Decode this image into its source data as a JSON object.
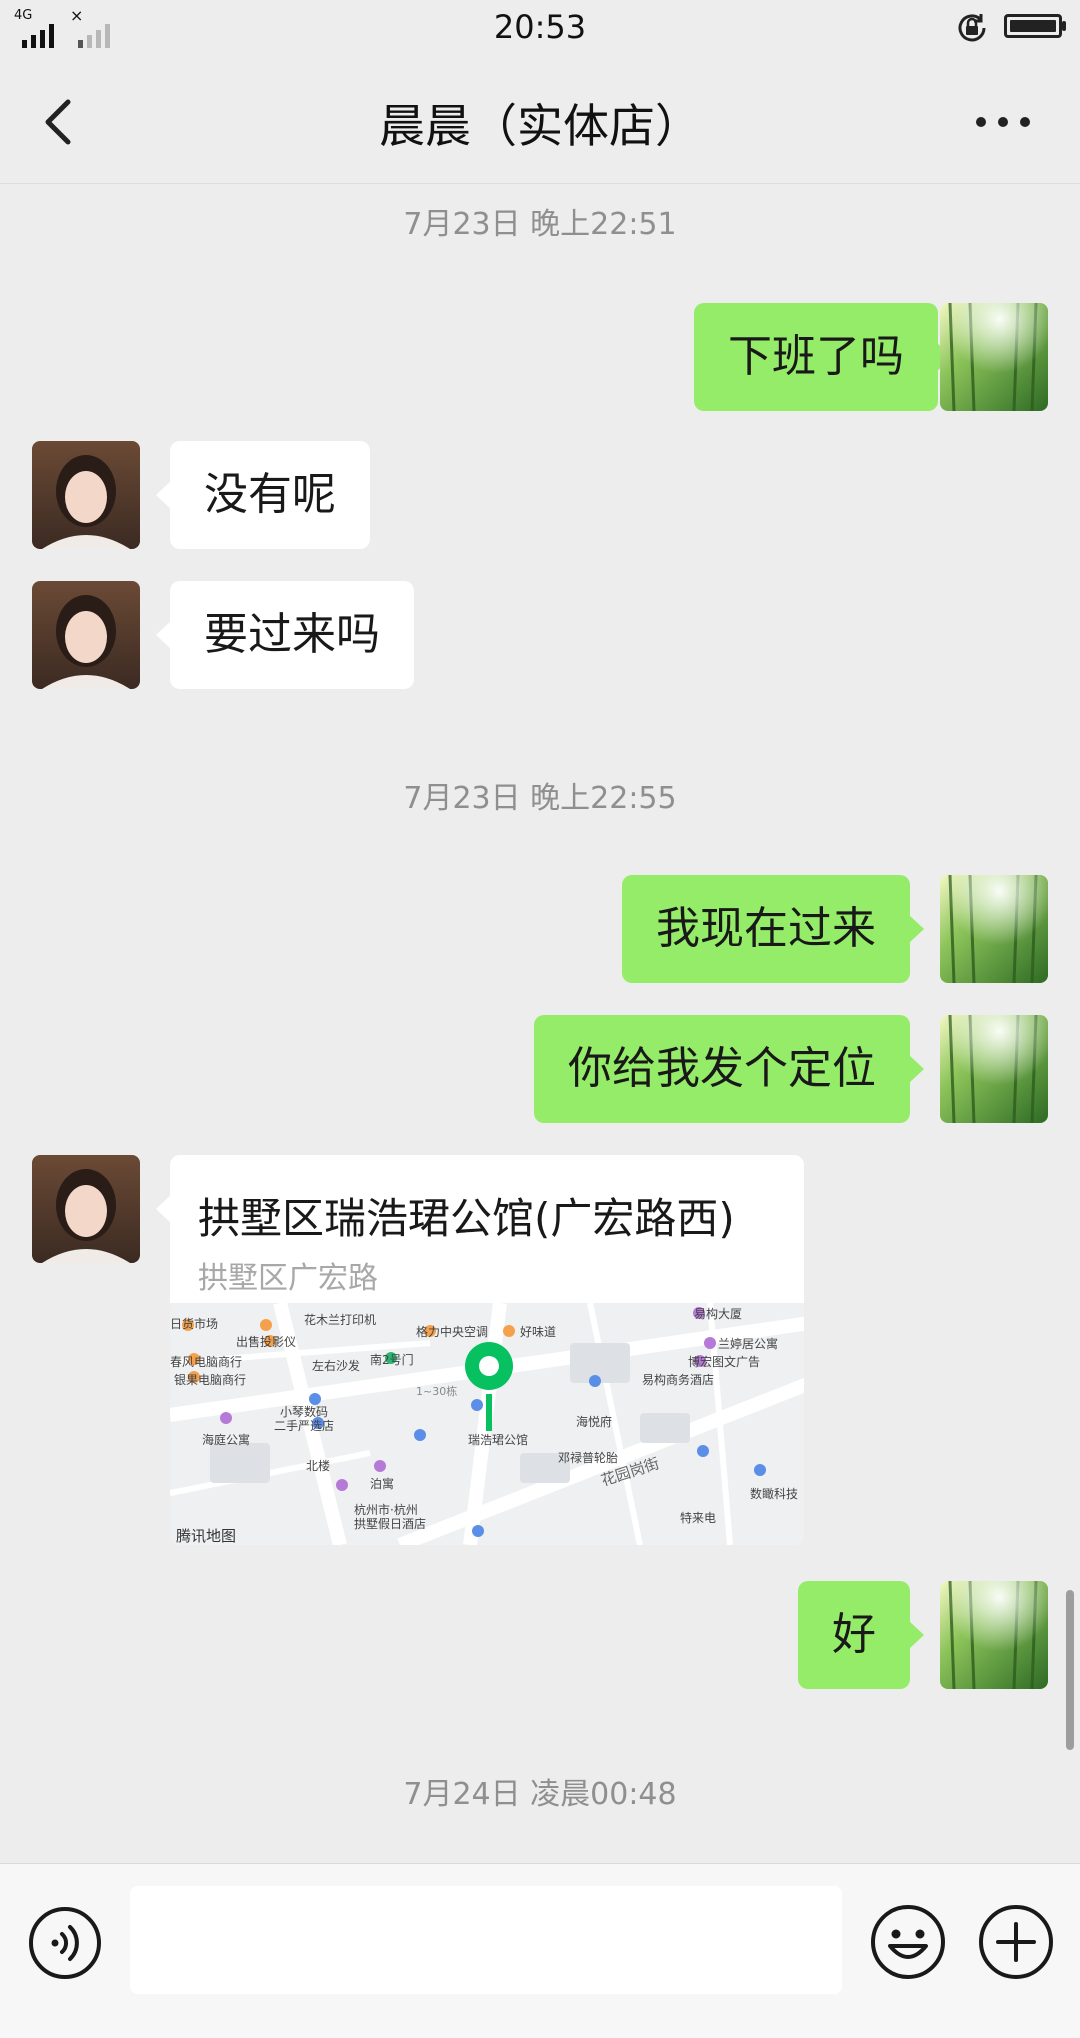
{
  "status_bar": {
    "time": "20:53",
    "network": "4G",
    "no_service": "×"
  },
  "nav": {
    "title": "晨晨（实体店）",
    "back_icon": "chevron-left-icon",
    "more_icon": "more-dots-icon"
  },
  "chat": {
    "timestamps": [
      "7月23日 晚上22:51",
      "7月23日 晚上22:55",
      "7月24日 凌晨00:48"
    ],
    "messages": [
      {
        "side": "sent",
        "text": "下班了吗"
      },
      {
        "side": "recv",
        "text": "没有呢"
      },
      {
        "side": "recv",
        "text": "要过来吗"
      },
      {
        "side": "sent",
        "text": "我现在过来"
      },
      {
        "side": "sent",
        "text": "你给我发个定位"
      },
      {
        "side": "sent",
        "text": "好"
      }
    ],
    "location": {
      "title": "拱墅区瑞浩珺公馆(广宏路西)",
      "address": "拱墅区广宏路",
      "map_provider": "腾讯地图",
      "map_labels": [
        "日货市场",
        "出售投影仪",
        "花木兰打印机",
        "格力中央空调",
        "好味道",
        "易构大厦",
        "兰婷居公寓",
        "博宏图文广告",
        "易构商务酒店",
        "春风电脑商行",
        "左右沙发",
        "南2号门",
        "银果电脑商行",
        "小琴数码",
        "二手严选店",
        "海庭公寓",
        "北楼",
        "泊寓",
        "瑞浩珺公馆",
        "海悦府",
        "邓禄普轮胎",
        "花园岗街",
        "杭州市·杭州",
        "拱墅假日酒店",
        "特来电",
        "数瞰科技",
        "1~30栋"
      ]
    }
  },
  "input_bar": {
    "voice_icon": "voice-icon",
    "emoji_icon": "emoji-icon",
    "plus_icon": "plus-circle-icon"
  },
  "colors": {
    "background": "#ededed",
    "sent_bubble": "#95ec69",
    "recv_bubble": "#ffffff",
    "pin": "#07c160"
  }
}
